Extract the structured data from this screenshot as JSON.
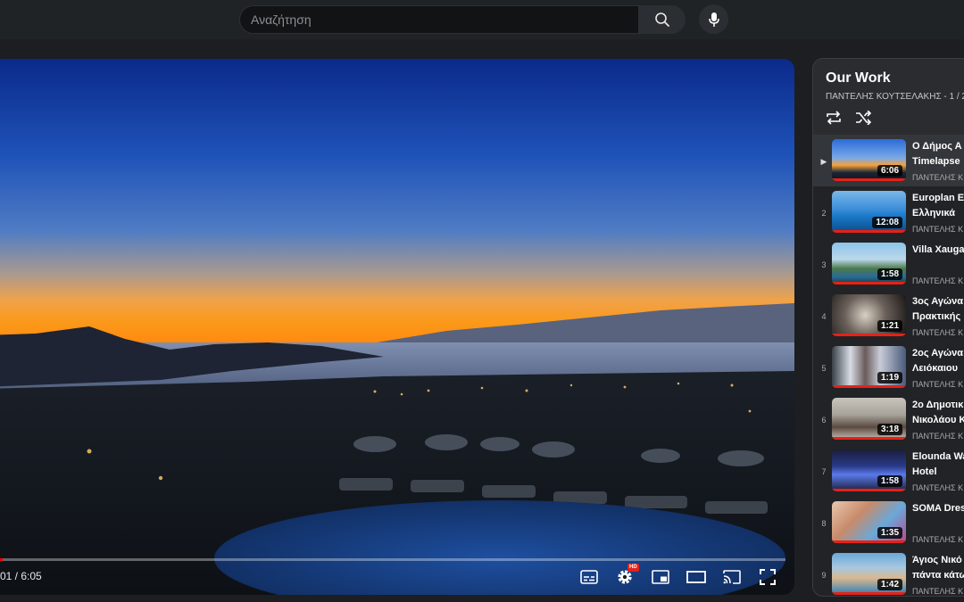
{
  "search": {
    "placeholder": "Αναζήτηση"
  },
  "icons": {
    "search": "search-icon",
    "mic": "microphone-icon",
    "subtitles": "subtitles-icon",
    "settings": "gear-icon",
    "miniplayer": "miniplayer-icon",
    "theater": "theater-mode-icon",
    "cast": "cast-icon",
    "fullscreen": "fullscreen-icon",
    "loop": "loop-icon",
    "shuffle": "shuffle-icon"
  },
  "player": {
    "time": "01 / 6:05",
    "progress": 0.003,
    "hd_badge": "HD"
  },
  "playlist": {
    "title": "Our Work",
    "subtitle": "ΠΑΝΤΕΛΗΣ ΚΟΥΤΣΕΛΑΚΗΣ - 1 / 2",
    "items": [
      {
        "index": "▶",
        "title1": "Ο Δήμος Α",
        "title2": "Timelapse",
        "channel": "ΠΑΝΤΕΛΗΣ Κ",
        "duration": "6:06",
        "active": true
      },
      {
        "index": "2",
        "title1": "Europlan E",
        "title2": "Ελληνικά",
        "channel": "ΠΑΝΤΕΛΗΣ Κ",
        "duration": "12:08"
      },
      {
        "index": "3",
        "title1": "Villa Xauga",
        "title2": "",
        "channel": "ΠΑΝΤΕΛΗΣ Κ",
        "duration": "1:58"
      },
      {
        "index": "4",
        "title1": "3ος Αγώνα",
        "title2": "Πρακτικής",
        "channel": "ΠΑΝΤΕΛΗΣ Κ",
        "duration": "1:21"
      },
      {
        "index": "5",
        "title1": "2ος Αγώνα",
        "title2": "Λειόκαιου",
        "channel": "ΠΑΝΤΕΛΗΣ Κ",
        "duration": "1:19"
      },
      {
        "index": "6",
        "title1": "2ο Δημοτικ",
        "title2": "Νικολάου Κ",
        "channel": "ΠΑΝΤΕΛΗΣ Κ",
        "duration": "3:18"
      },
      {
        "index": "7",
        "title1": "Elounda Wa",
        "title2": "Hotel",
        "channel": "ΠΑΝΤΕΛΗΣ Κ",
        "duration": "1:58"
      },
      {
        "index": "8",
        "title1": "SOMA Dres",
        "title2": "",
        "channel": "ΠΑΝΤΕΛΗΣ Κ",
        "duration": "1:35"
      },
      {
        "index": "9",
        "title1": "Άγιος Νικό",
        "title2": "πάντα κάτω",
        "channel": "ΠΑΝΤΕΛΗΣ Κ",
        "duration": "1:42"
      }
    ]
  }
}
